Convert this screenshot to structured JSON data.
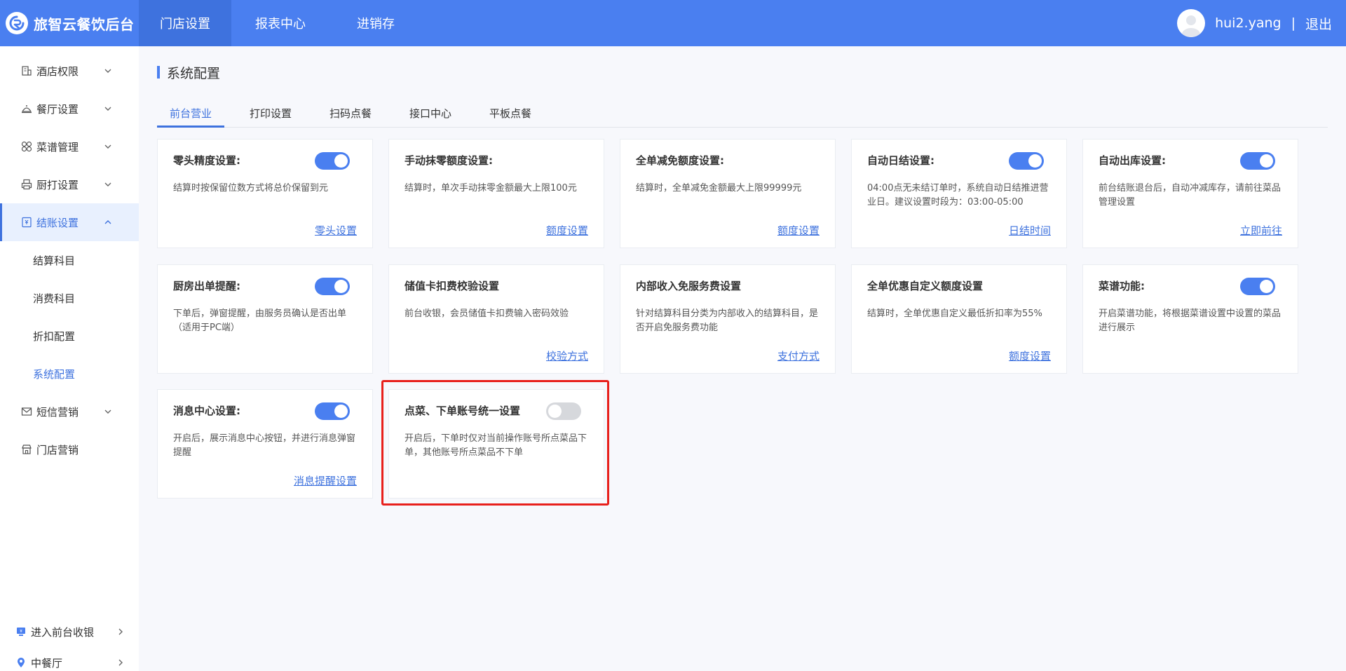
{
  "brand": {
    "title": "旅智云餐饮后台"
  },
  "topnav": [
    {
      "label": "门店设置",
      "active": true
    },
    {
      "label": "报表中心",
      "active": false
    },
    {
      "label": "进销存",
      "active": false
    }
  ],
  "user": {
    "name": "hui2.yang",
    "separator": "|",
    "logout": "退出"
  },
  "sidebar": {
    "items": [
      {
        "label": "酒店权限",
        "icon": "hotel-icon"
      },
      {
        "label": "餐厅设置",
        "icon": "restaurant-icon"
      },
      {
        "label": "菜谱管理",
        "icon": "grid-icon"
      },
      {
        "label": "厨打设置",
        "icon": "printer-icon"
      },
      {
        "label": "结账设置",
        "icon": "checkout-icon",
        "active": true,
        "expanded": true
      }
    ],
    "subitems": [
      {
        "label": "结算科目"
      },
      {
        "label": "消费科目"
      },
      {
        "label": "折扣配置"
      },
      {
        "label": "系统配置",
        "active": true
      }
    ],
    "items_after": [
      {
        "label": "短信营销",
        "icon": "mail-icon"
      },
      {
        "label": "门店营销",
        "icon": "store-icon"
      }
    ],
    "bottom": [
      {
        "label": "进入前台收银",
        "icon": "cashier-icon"
      },
      {
        "label": "中餐厅",
        "icon": "location-pin-icon"
      }
    ]
  },
  "page": {
    "title": "系统配置"
  },
  "tabs": [
    {
      "label": "前台营业",
      "active": true
    },
    {
      "label": "打印设置"
    },
    {
      "label": "扫码点餐"
    },
    {
      "label": "接口中心"
    },
    {
      "label": "平板点餐"
    }
  ],
  "cards": [
    {
      "title": "零头精度设置:",
      "desc": "结算时按保留位数方式将总价保留到元",
      "link": "零头设置",
      "toggle": "on"
    },
    {
      "title": "手动抹零额度设置:",
      "desc": "结算时，单次手动抹零金额最大上限100元",
      "link": "额度设置"
    },
    {
      "title": "全单减免额度设置:",
      "desc": "结算时，全单减免金额最大上限99999元",
      "link": "额度设置"
    },
    {
      "title": "自动日结设置:",
      "desc": "04:00点无未结订单时，系统自动日结推进营业日。建议设置时段为：03:00-05:00",
      "link": "日结时间",
      "toggle": "on"
    },
    {
      "title": "自动出库设置:",
      "desc": "前台结账退台后，自动冲减库存，请前往菜品管理设置",
      "link": "立即前往",
      "toggle": "on"
    },
    {
      "title": "厨房出单提醒:",
      "desc": "下单后，弹窗提醒，由服务员确认是否出单（适用于PC端）",
      "toggle": "on"
    },
    {
      "title": "储值卡扣费校验设置",
      "desc": "前台收银，会员储值卡扣费输入密码效验",
      "link": "校验方式"
    },
    {
      "title": "内部收入免服务费设置",
      "desc": "针对结算科目分类为内部收入的结算科目，是否开启免服务费功能",
      "link": "支付方式"
    },
    {
      "title": "全单优惠自定义额度设置",
      "desc": "结算时，全单优惠自定义最低折扣率为55%",
      "link": "额度设置"
    },
    {
      "title": "菜谱功能:",
      "desc": "开启菜谱功能，将根据菜谱设置中设置的菜品进行展示",
      "toggle": "on"
    },
    {
      "title": "消息中心设置:",
      "desc": "开启后，展示消息中心按钮，并进行消息弹窗提醒",
      "link": "消息提醒设置",
      "toggle": "on"
    },
    {
      "title": "点菜、下单账号统一设置",
      "desc": "开启后，下单时仅对当前操作账号所点菜品下单，其他账号所点菜品不下单",
      "toggle": "off"
    }
  ],
  "colors": {
    "primary": "#4a7ff0",
    "highlight": "#e8201c"
  }
}
